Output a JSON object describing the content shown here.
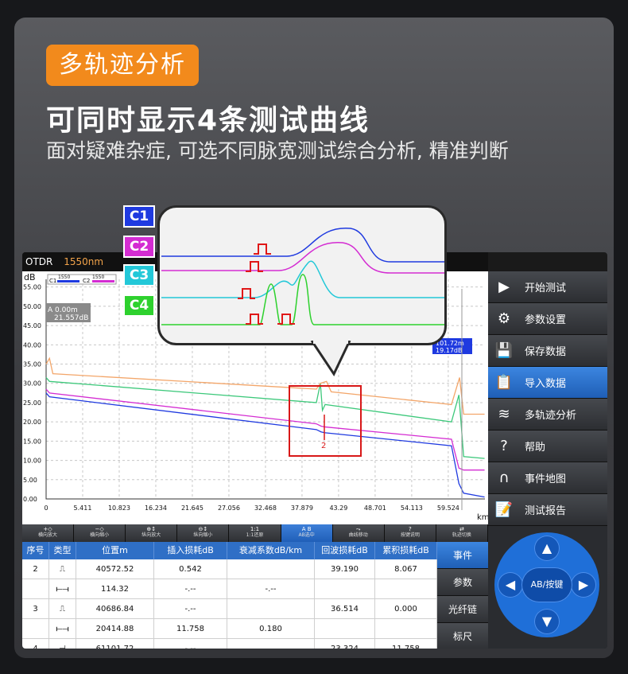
{
  "header": {
    "badge": "多轨迹分析",
    "headline": "可同时显示4条测试曲线",
    "subtitle": "面对疑难杂症, 可选不同脉宽测试综合分析, 精准判断"
  },
  "bubble": {
    "labels": [
      {
        "text": "C1",
        "color": "#1f3ae0"
      },
      {
        "text": "C2",
        "color": "#d42cd2"
      },
      {
        "text": "C3",
        "color": "#23c8d8"
      },
      {
        "text": "C4",
        "color": "#2ed12e"
      }
    ]
  },
  "otdr": {
    "app_title": "OTDR",
    "wavelength": "1550nm",
    "ylabel": "dB",
    "xunit": "km",
    "legend": [
      {
        "name": "C1",
        "value": "1550"
      },
      {
        "name": "C2",
        "value": "1550"
      }
    ],
    "cursor_a": {
      "label": "A 0.00m",
      "value": "21.557dB"
    },
    "cursor_b": {
      "label": "101.72m",
      "value": "19.17dB"
    },
    "event_marker": "2",
    "colors": {
      "c1": "#1f3ae0",
      "c2": "#d42cd2",
      "c3": "#23c8a0",
      "c4": "#f3a66a",
      "accent": "#2f6fc6"
    }
  },
  "chart_data": {
    "type": "line",
    "xlabel": "km",
    "ylabel": "dB",
    "xlim": [
      0,
      64.95
    ],
    "ylim": [
      0,
      57
    ],
    "x_ticks": [
      "0",
      "5.411",
      "10.823",
      "16.234",
      "21.645",
      "27.056",
      "32.468",
      "37.879",
      "43.29",
      "48.701",
      "54.113",
      "59.524"
    ],
    "y_ticks": [
      "55.00",
      "50.00",
      "45.00",
      "40.00",
      "35.00",
      "30.00",
      "25.00",
      "20.00",
      "15.00",
      "10.00",
      "5.00",
      "0.00"
    ],
    "series": [
      {
        "name": "C1",
        "color": "#1f3ae0",
        "x": [
          0,
          0.5,
          40,
          40.7,
          41.2,
          60,
          61.1,
          61.8,
          64.9
        ],
        "y": [
          27.5,
          26.5,
          18.0,
          17.4,
          17.2,
          13.8,
          4.0,
          1.5,
          0.5
        ]
      },
      {
        "name": "C2",
        "color": "#d42cd2",
        "x": [
          0,
          0.5,
          40,
          40.7,
          41.2,
          60,
          61.1,
          61.8,
          64.9
        ],
        "y": [
          28.5,
          27.5,
          19.5,
          18.9,
          18.7,
          15.5,
          8.0,
          7.5,
          7.5
        ]
      },
      {
        "name": "C3",
        "color": "#3cc87a",
        "x": [
          0,
          0.5,
          40,
          40.6,
          40.9,
          41.3,
          60,
          61.1,
          61.8,
          64.9
        ],
        "y": [
          31.5,
          30.5,
          25.0,
          30.0,
          23.0,
          24.5,
          20.0,
          27.0,
          11.0,
          10.5
        ]
      },
      {
        "name": "C4",
        "color": "#f3a66a",
        "x": [
          0,
          0.5,
          1.0,
          40,
          40.6,
          41.5,
          42.2,
          60,
          61.2,
          61.8,
          64.9
        ],
        "y": [
          35.0,
          36.5,
          32.5,
          28.5,
          30.0,
          30.5,
          27.8,
          24.5,
          31.5,
          22.0,
          22.0
        ]
      }
    ]
  },
  "toolbar": [
    {
      "icon": "+◇",
      "label": "横向放大"
    },
    {
      "icon": "−◇",
      "label": "横向缩小"
    },
    {
      "icon": "⊕↕",
      "label": "纵向放大"
    },
    {
      "icon": "⊖↕",
      "label": "纵向缩小"
    },
    {
      "icon": "1:1",
      "label": "1:1还原"
    },
    {
      "icon": "A B",
      "label": "AB选中"
    },
    {
      "icon": "⤳",
      "label": "曲线移动"
    },
    {
      "icon": "?",
      "label": "按键说明"
    },
    {
      "icon": "⇄",
      "label": "轨迹切换"
    }
  ],
  "table": {
    "headers": [
      "序号",
      "类型",
      "位置m",
      "插入损耗dB",
      "衰减系数dB/km",
      "回波损耗dB",
      "累积损耗dB"
    ],
    "rows": [
      [
        "2",
        "⎍",
        "40572.52",
        "0.542",
        "",
        "39.190",
        "8.067"
      ],
      [
        "",
        "⟝⟞",
        "114.32",
        "-.--",
        "-.--",
        "",
        ""
      ],
      [
        "3",
        "⎍",
        "40686.84",
        "-.--",
        "",
        "36.514",
        "0.000"
      ],
      [
        "",
        "⟝⟞",
        "20414.88",
        "11.758",
        "0.180",
        "",
        ""
      ],
      [
        "4",
        "⊣",
        "61101.72",
        "-.--",
        "",
        "23.324",
        "11.758"
      ]
    ]
  },
  "tabs": [
    "事件",
    "参数",
    "光纤链",
    "标尺"
  ],
  "menu": [
    {
      "icon": "▶",
      "label": "开始测试"
    },
    {
      "icon": "⚙",
      "label": "参数设置"
    },
    {
      "icon": "💾",
      "label": "保存数据"
    },
    {
      "icon": "📋",
      "label": "导入数据"
    },
    {
      "icon": "≋",
      "label": "多轨迹分析"
    },
    {
      "icon": "?",
      "label": "帮助"
    },
    {
      "icon": "∩",
      "label": "事件地图"
    },
    {
      "icon": "📝",
      "label": "测试报告"
    }
  ],
  "dpad": {
    "up": "▲",
    "down": "▼",
    "left": "◀",
    "right": "▶",
    "center": "AB/按键"
  }
}
